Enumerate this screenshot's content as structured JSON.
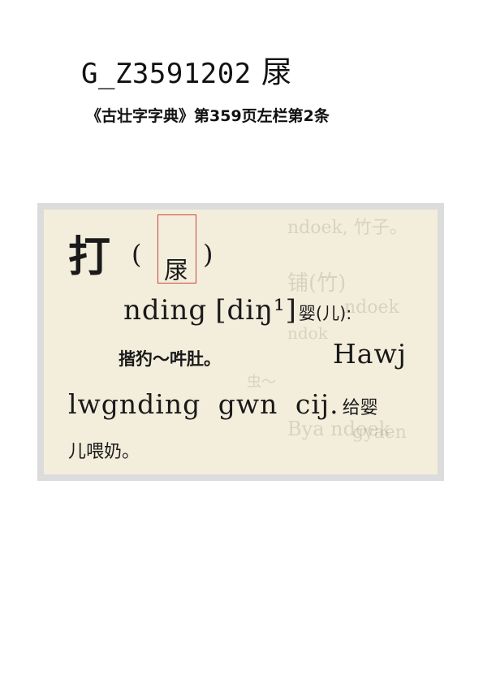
{
  "header": {
    "code": "G_Z3591202",
    "character": "㞗"
  },
  "source_reference": "《古壮字字典》第359页左栏第2条",
  "scan": {
    "headword": "打",
    "paren_open": "(",
    "variant": "㞗",
    "paren_close": ")",
    "reading": "nding",
    "ipa": "[diŋ¹]",
    "gloss_1": "婴(儿):",
    "example_zhuang_chars": "揩犳～吽肚。",
    "example_latin_part1": "Hawj",
    "example_latin_part2": "lwgnding gwn cij.",
    "gloss_2": "给婴",
    "gloss_3": "儿喂奶。",
    "bleed_through": [
      "ndoek, 竹子。",
      "铺(竹)",
      "ndoek",
      "ndok",
      "虫～",
      "Bya ndoek",
      "gyaen"
    ]
  },
  "colors": {
    "highlight_box": "#c9423f",
    "paper": "#f3eedc",
    "scan_border": "#dcdcdc"
  }
}
